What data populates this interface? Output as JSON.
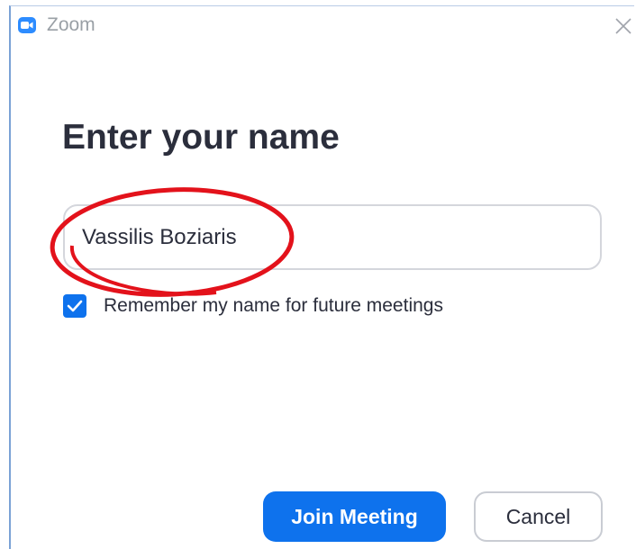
{
  "window": {
    "title": "Zoom",
    "app_icon": "zoom-camera-icon",
    "close_icon": "close-icon"
  },
  "dialog": {
    "heading": "Enter your name",
    "name_input": {
      "value": "Vassilis Boziaris",
      "placeholder": ""
    },
    "remember": {
      "label": "Remember my name for future meetings",
      "checked": true
    },
    "join_button": "Join Meeting",
    "cancel_button": "Cancel"
  },
  "annotation": {
    "type": "ellipse",
    "color": "#e3121b"
  },
  "colors": {
    "accent": "#0e72ed",
    "heading": "#2b2e3c",
    "title_text": "#9aa0a6"
  }
}
